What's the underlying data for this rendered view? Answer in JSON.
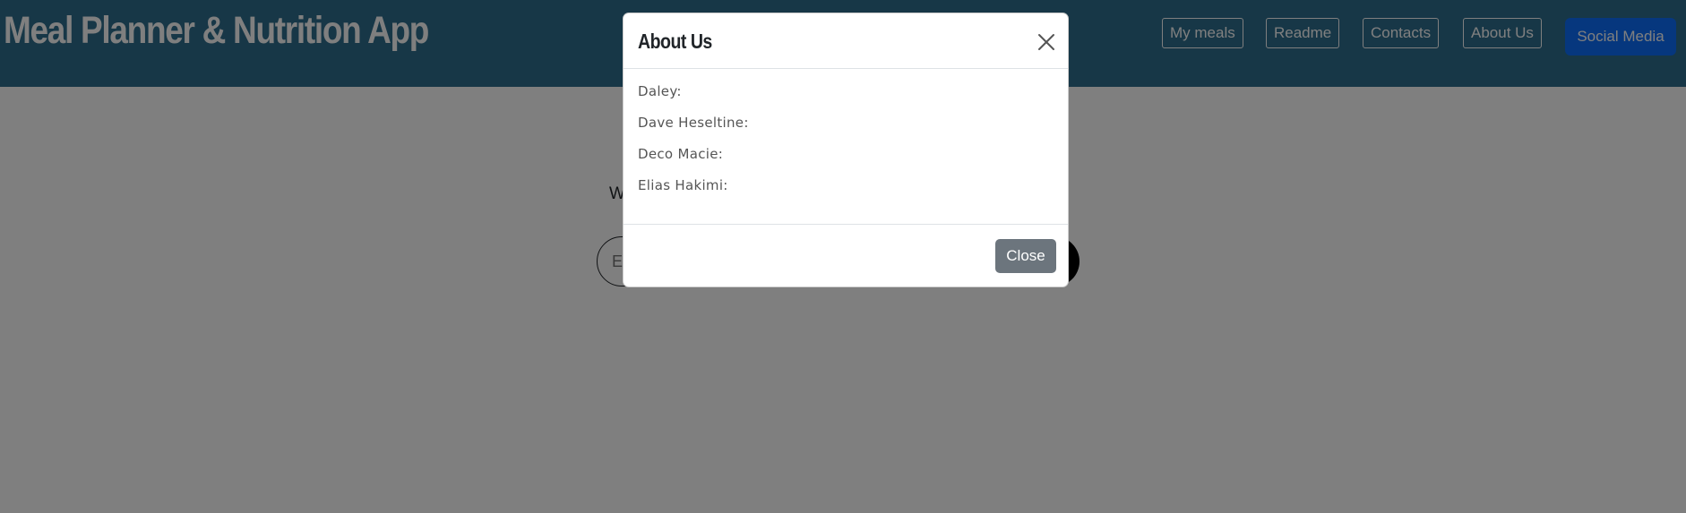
{
  "header": {
    "title": "Meal Planner & Nutrition App",
    "nav": [
      "My meals",
      "Readme",
      "Contacts",
      "About Us"
    ],
    "social_label": "Social Media"
  },
  "main": {
    "welcome_text": "W",
    "email_placeholder": "E"
  },
  "modal": {
    "title": "About Us",
    "close_icon": "close-icon",
    "members": [
      "Daley:",
      "Dave Heseltine:",
      "Deco Macie:",
      "Elias Hakimi:"
    ],
    "close_label": "Close"
  },
  "colors": {
    "header_bg": "#2e6f8e",
    "social_button": "#0d6efd",
    "close_button": "#6c757d"
  }
}
